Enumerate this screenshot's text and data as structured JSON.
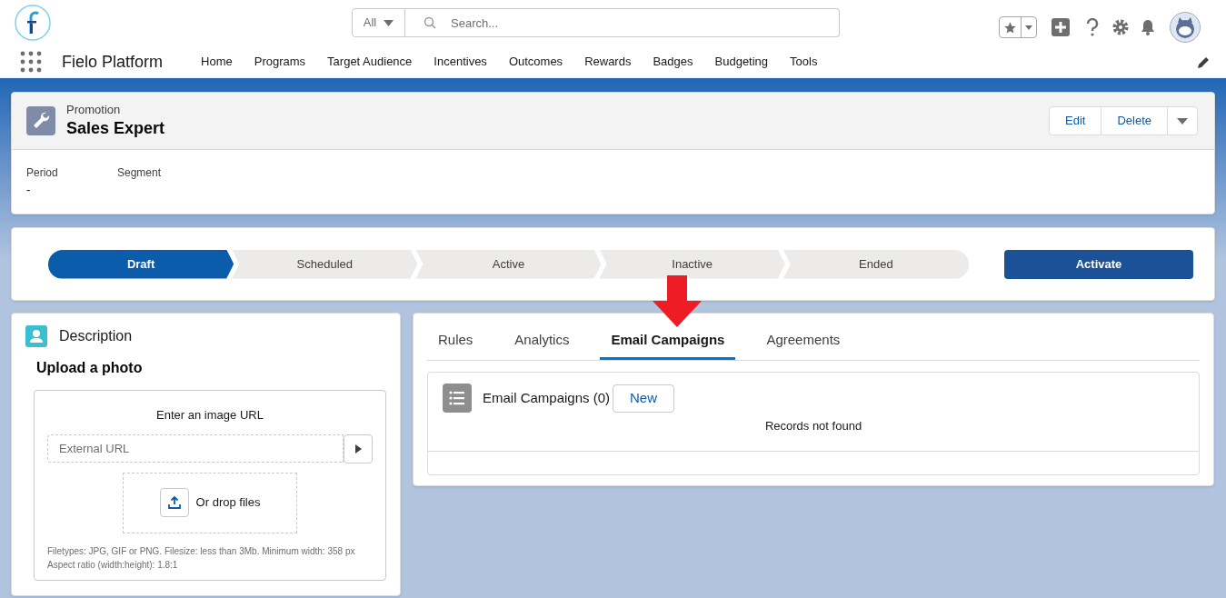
{
  "header": {
    "search_scope": "All",
    "search_placeholder": "Search..."
  },
  "app": {
    "name": "Fielo Platform"
  },
  "nav": [
    {
      "label": "Home"
    },
    {
      "label": "Programs"
    },
    {
      "label": "Target Audience"
    },
    {
      "label": "Incentives"
    },
    {
      "label": "Outcomes"
    },
    {
      "label": "Rewards"
    },
    {
      "label": "Badges"
    },
    {
      "label": "Budgeting"
    },
    {
      "label": "Tools"
    }
  ],
  "record": {
    "type": "Promotion",
    "name": "Sales Expert",
    "actions": [
      "Edit",
      "Delete"
    ],
    "fields": [
      {
        "label": "Period",
        "value": "-"
      },
      {
        "label": "Segment"
      }
    ]
  },
  "path": {
    "stages": [
      {
        "label": "Draft",
        "selected": true
      },
      {
        "label": "Scheduled",
        "selected": false
      },
      {
        "label": "Active",
        "selected": false
      },
      {
        "label": "Inactive",
        "selected": false
      },
      {
        "label": "Ended",
        "selected": false
      }
    ],
    "action": "Activate"
  },
  "description": {
    "title": "Description",
    "heading": "Upload a photo",
    "prompt": "Enter an image URL",
    "url_placeholder": "External URL",
    "drop_label": "Or drop files",
    "hints": [
      "Filetypes: JPG, GIF or PNG. Filesize: less than 3Mb. Minimum width: 358 px",
      "Aspect ratio (width:height): 1.8:1"
    ]
  },
  "tabs": [
    {
      "label": "Rules",
      "selected": false
    },
    {
      "label": "Analytics",
      "selected": false
    },
    {
      "label": "Email Campaigns",
      "selected": true
    },
    {
      "label": "Agreements",
      "selected": false
    }
  ],
  "related": {
    "title": "Email Campaigns (0)",
    "new": "New",
    "empty": "Records not found"
  }
}
